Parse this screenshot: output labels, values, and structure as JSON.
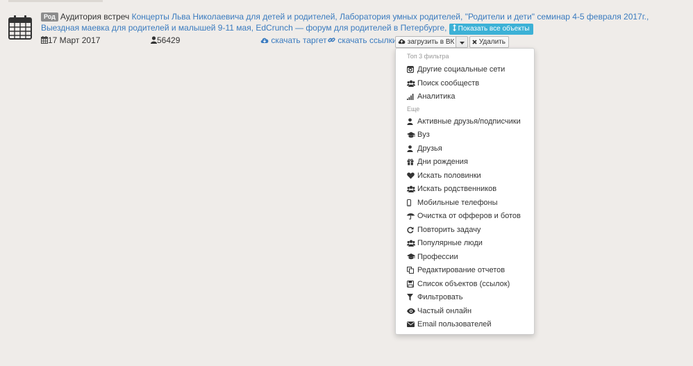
{
  "header": {
    "badge": "Род",
    "title_prefix": "Аудитория встреч",
    "objects": [
      "Концерты Льва Николаевича для детей и родителей,",
      "Лаборатория умных родителей,",
      "\"Родители и дети\" семинар 4-5 февраля 2017г.,",
      "Выездная маевка для родителей и малышей 9-11 мая,",
      "EdCrunch — форум для родителей в Петербурге,"
    ],
    "show_all_label": "Показать все объекты"
  },
  "meta": {
    "date": "17 Март 2017",
    "count": "56429",
    "download_target": "скачать таргет",
    "download_links": "скачать ссылки"
  },
  "actions": {
    "upload_vk": "загрузить в ВК",
    "delete": "Удалить"
  },
  "dropdown": {
    "header_top": "Топ 3 фильтра",
    "header_more": "Еще",
    "items": [
      {
        "label": "Другие социальные сети",
        "icon": "instagram-icon"
      },
      {
        "label": "Поиск сообществ",
        "icon": "users-icon"
      },
      {
        "label": "Аналитика",
        "icon": "signal-icon"
      },
      {
        "label": "Активные друзья/подписчики",
        "icon": "user-icon"
      },
      {
        "label": "Вуз",
        "icon": "graduation-cap-icon"
      },
      {
        "label": "Друзья",
        "icon": "user-icon"
      },
      {
        "label": "Дни рождения",
        "icon": "gift-icon"
      },
      {
        "label": "Искать половинки",
        "icon": "heart-icon"
      },
      {
        "label": "Искать родственников",
        "icon": "users-icon"
      },
      {
        "label": "Мобильные телефоны",
        "icon": "mobile-icon"
      },
      {
        "label": "Очистка от офферов и ботов",
        "icon": "umbrella-icon"
      },
      {
        "label": "Повторить задачу",
        "icon": "refresh-icon"
      },
      {
        "label": "Популярные люди",
        "icon": "users-icon"
      },
      {
        "label": "Профессии",
        "icon": "graduation-cap-icon"
      },
      {
        "label": "Редактирование отчетов",
        "icon": "copy-icon"
      },
      {
        "label": "Список объектов (ссылок)",
        "icon": "save-icon"
      },
      {
        "label": "Фильтровать",
        "icon": "filter-icon"
      },
      {
        "label": "Частый онлайн",
        "icon": "eye-icon"
      },
      {
        "label": "Email пользователей",
        "icon": "envelope-icon"
      }
    ]
  }
}
